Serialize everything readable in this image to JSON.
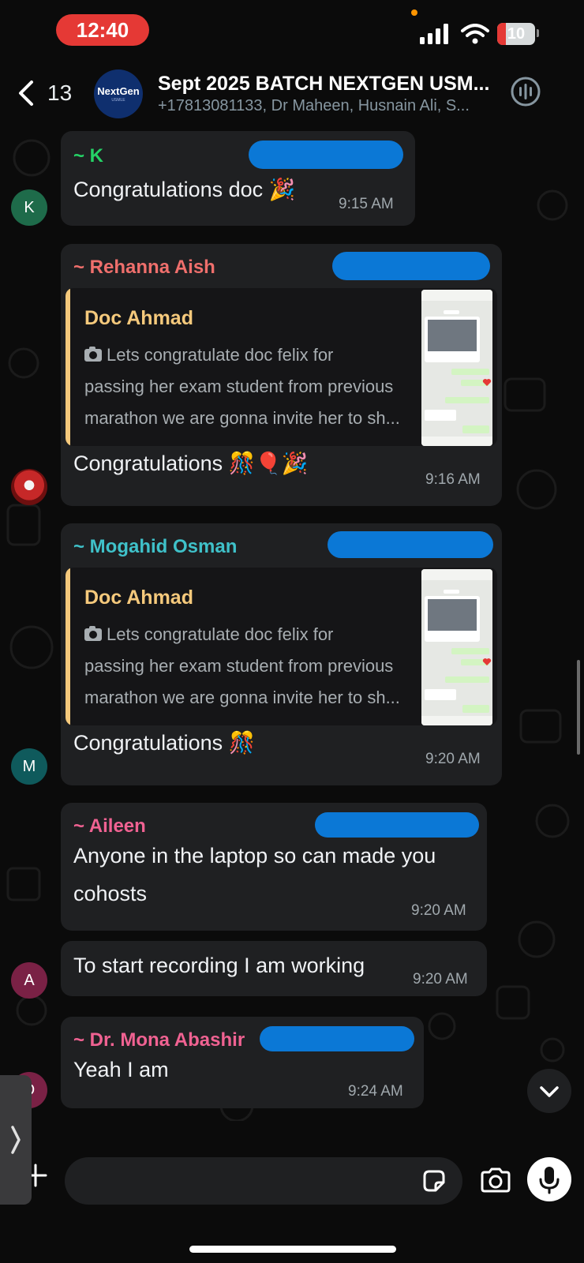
{
  "status_bar": {
    "time": "12:40",
    "battery_level": "10",
    "battery_fraction": 0.1,
    "battery_color": "#e53935"
  },
  "header": {
    "back_count": "13",
    "group_logo": "NextGen",
    "group_logo_sub": "USMLE",
    "title": "Sept  2025 BATCH NEXTGEN USM...",
    "members": "+17813081133, Dr Maheen, Husnain Ali, S..."
  },
  "messages": [
    {
      "sender": "~ K",
      "sender_color": "#25d366",
      "text": "Congratulations doc 🎉",
      "time": "9:15 AM",
      "avatar_letter": "K",
      "avatar_color": "#1e6b4a"
    },
    {
      "sender": "~ Rehanna Aish",
      "sender_color": "#ef6f6c",
      "quote": {
        "author": "Doc Ahmad",
        "lines": [
          "Lets congratulate doc felix for",
          "passing her exam student from previous",
          "marathon we are gonna invite her to sh..."
        ]
      },
      "text": "Congratulations 🎊🎈🎉",
      "time": "9:16 AM"
    },
    {
      "sender": "~ Mogahid Osman",
      "sender_color": "#3fc1c9",
      "quote": {
        "author": "Doc Ahmad",
        "lines": [
          "Lets congratulate doc felix for",
          "passing her exam student from previous",
          "marathon we are gonna invite her to sh..."
        ]
      },
      "text": "Congratulations 🎊",
      "time": "9:20 AM",
      "avatar_letter": "M",
      "avatar_color": "#0f5a5c"
    },
    {
      "sender": "~ Aileen",
      "sender_color": "#f06292",
      "text_lines": [
        "Anyone in the laptop so can made you",
        "cohosts"
      ],
      "time": "9:20 AM"
    },
    {
      "text": "To start recording I am working",
      "time": "9:20 AM",
      "avatar_letter": "A",
      "avatar_color": "#7a2145"
    },
    {
      "sender": "~ Dr. Mona Abashir",
      "sender_color": "#f06292",
      "text": "Yeah I am",
      "time": "9:24 AM",
      "avatar_letter": "D",
      "avatar_color": "#7a2145"
    }
  ]
}
